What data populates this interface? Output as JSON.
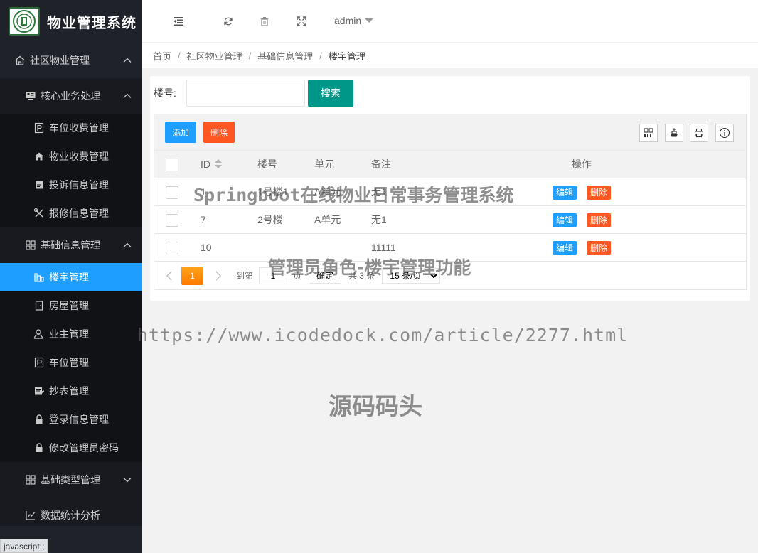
{
  "app": {
    "title": "物业管理系统"
  },
  "header": {
    "user": "admin"
  },
  "sidebar": {
    "groups": [
      {
        "label": "社区物业管理"
      },
      {
        "label": "核心业务处理"
      },
      {
        "label": "基础信息管理"
      },
      {
        "label": "基础类型管理"
      },
      {
        "label": "数据统计分析"
      }
    ],
    "core_items": [
      "车位收费管理",
      "物业收费管理",
      "投诉信息管理",
      "报修信息管理"
    ],
    "basic_items": [
      "楼宇管理",
      "房屋管理",
      "业主管理",
      "车位管理",
      "抄表管理",
      "登录信息管理",
      "修改管理员密码"
    ],
    "active": "楼宇管理"
  },
  "status_bar": "javascript:;",
  "breadcrumb": [
    "首页",
    "社区物业管理",
    "基础信息管理",
    "楼宇管理"
  ],
  "search": {
    "label": "楼号:",
    "value": "",
    "placeholder": "",
    "button": "搜索"
  },
  "toolbar": {
    "add": "添加",
    "delete": "删除"
  },
  "table": {
    "columns": [
      "ID",
      "楼号",
      "单元",
      "备注",
      "操作"
    ],
    "rows": [
      {
        "id": "1",
        "building": "1号楼1",
        "unit": "A单元",
        "note": "无1"
      },
      {
        "id": "7",
        "building": "2号楼",
        "unit": "A单元",
        "note": "无1"
      },
      {
        "id": "10",
        "building": "",
        "unit": "",
        "note": "11111"
      }
    ],
    "edit_label": "编辑",
    "delete_label": "删除"
  },
  "pager": {
    "current": "1",
    "goto_prefix": "到第",
    "goto_value": "1",
    "goto_suffix": "页",
    "confirm": "确定",
    "total": "共 3 条",
    "page_size": "15 条/页"
  },
  "watermarks": [
    "Springboot在线物业日常事务管理系统",
    "管理员角色-楼宇管理功能",
    "https://www.icodedock.com/article/2277.html",
    "源码码头"
  ]
}
